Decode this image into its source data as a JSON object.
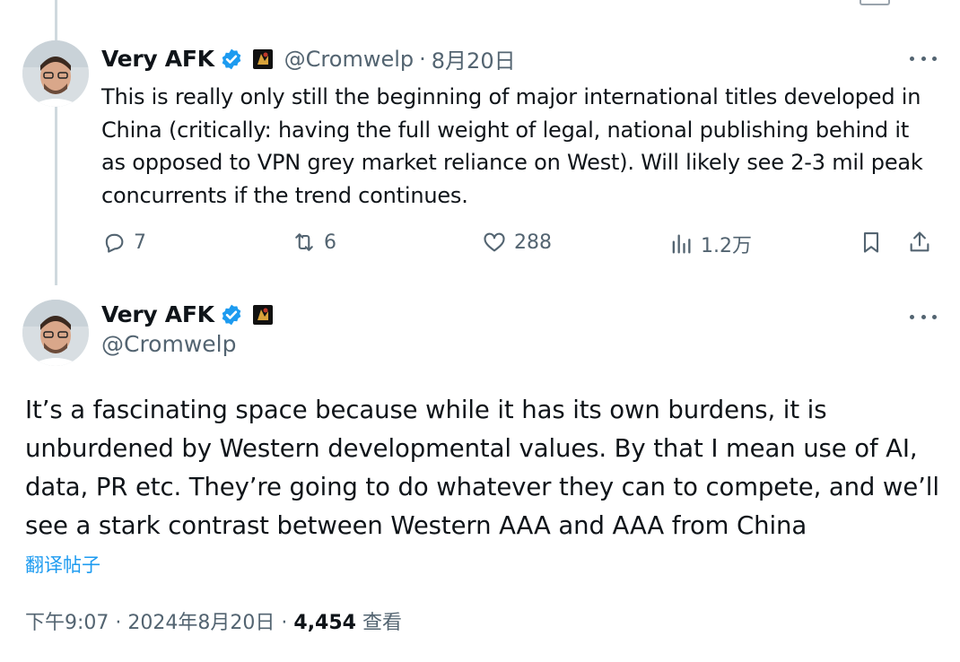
{
  "tweet1": {
    "display_name": "Very AFK",
    "handle": "@Cromwelp",
    "separator": "·",
    "date": "8月20日",
    "text": "This is really only still the beginning of major international titles developed in China (critically: having the full weight of legal, national publishing behind it as opposed to VPN grey market reliance on West). Will likely see 2-3 mil peak concurrents if the trend continues.",
    "replies": "7",
    "reposts": "6",
    "likes": "288",
    "views": "1.2万"
  },
  "tweet2": {
    "display_name": "Very AFK",
    "handle": "@Cromwelp",
    "text": "It’s a fascinating space because while it has its own burdens, it is unburdened by Western developmental values. By that I mean use of AI, data, PR etc. They’re going to do whatever they can to compete, and we’ll see a stark contrast between Western AAA and AAA from China",
    "translate_label": "翻译帖子",
    "time": "下午9:07",
    "separator": "·",
    "full_date": "2024年8月20日",
    "view_count": "4,454",
    "views_label": "查看"
  },
  "colors": {
    "accent": "#1d9bf0",
    "secondary_text": "#536471",
    "thread_line": "#cfd9de"
  },
  "icons": [
    "verified-badge-icon",
    "affiliate-icon",
    "more-options-icon",
    "reply-icon",
    "repost-icon",
    "like-icon",
    "views-icon",
    "bookmark-icon",
    "share-icon"
  ]
}
